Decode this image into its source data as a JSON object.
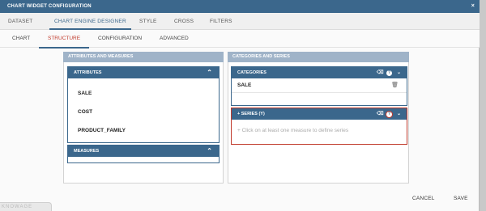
{
  "window": {
    "title": "CHART WIDGET CONFIGURATION"
  },
  "tabs_primary": [
    "DATASET",
    "CHART ENGINE DESIGNER",
    "STYLE",
    "CROSS",
    "FILTERS"
  ],
  "tabs_secondary": [
    "CHART",
    "STRUCTURE",
    "CONFIGURATION",
    "ADVANCED"
  ],
  "left_column": {
    "header": "ATTRIBUTES AND MEASURES",
    "attributes_panel": {
      "title": "ATTRIBUTES",
      "items": [
        "SALE",
        "COST",
        "PRODUCT_FAMILY"
      ]
    },
    "measures_panel": {
      "title": "MEASURES"
    }
  },
  "right_column": {
    "header": "CATEGORIES AND SERIES",
    "categories_panel": {
      "title": "CATEGORIES",
      "items": [
        "SALE"
      ]
    },
    "series_panel": {
      "title": "+ SERIES (Y)",
      "empty_message": "+ Click on at least one measure to define series"
    }
  },
  "footer": {
    "cancel": "CANCEL",
    "save": "SAVE"
  },
  "watermark": "KNOWAGE",
  "colors": {
    "primary": "#3b678c",
    "active_tab_text": "#c0392b",
    "highlight_border": "#c0392b"
  }
}
